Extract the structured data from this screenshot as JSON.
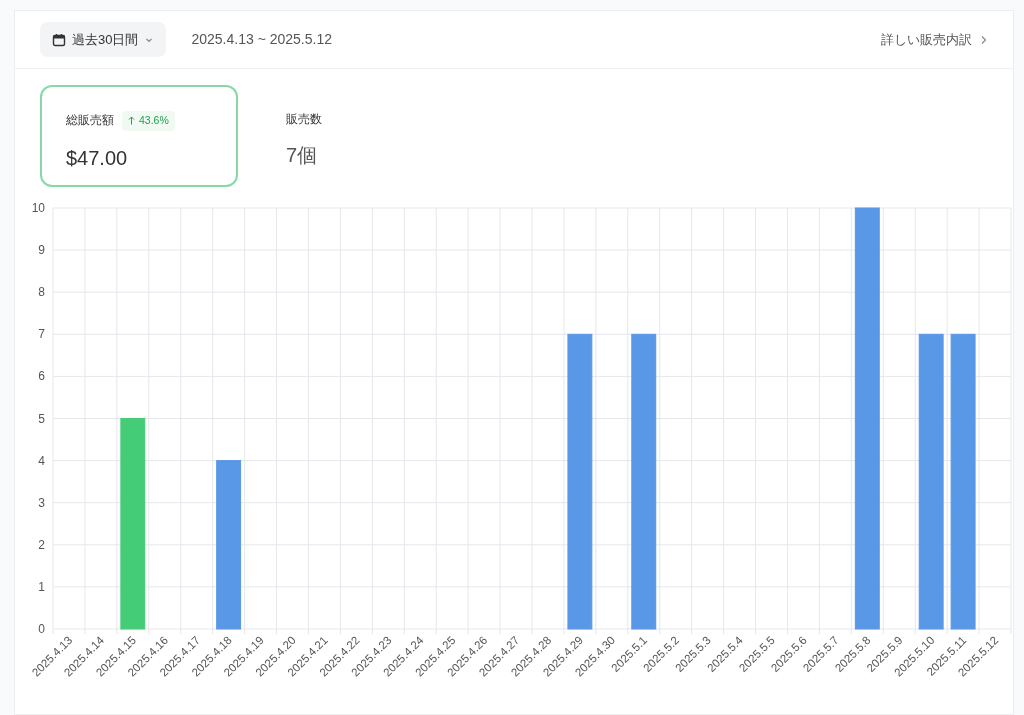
{
  "header": {
    "period_button": "過去30日間",
    "date_range": "2025.4.13 ~ 2025.5.12",
    "detail_link": "詳しい販売内訳"
  },
  "stats": [
    {
      "label": "総販売額",
      "badge": "43.6%",
      "value": "$47.00",
      "selected": true
    },
    {
      "label": "販売数",
      "value": "7個",
      "selected": false
    }
  ],
  "chart_data": {
    "type": "bar",
    "stacked": true,
    "categories": [
      "2025.4.13",
      "2025.4.14",
      "2025.4.15",
      "2025.4.16",
      "2025.4.17",
      "2025.4.18",
      "2025.4.19",
      "2025.4.20",
      "2025.4.21",
      "2025.4.22",
      "2025.4.23",
      "2025.4.24",
      "2025.4.25",
      "2025.4.26",
      "2025.4.27",
      "2025.4.28",
      "2025.4.29",
      "2025.4.30",
      "2025.5.1",
      "2025.5.2",
      "2025.5.3",
      "2025.5.4",
      "2025.5.5",
      "2025.5.6",
      "2025.5.7",
      "2025.5.8",
      "2025.5.9",
      "2025.5.10",
      "2025.5.11",
      "2025.5.12"
    ],
    "grid": true,
    "series": [
      {
        "color": "#4ade80",
        "values": [
          0,
          0,
          5,
          0,
          0,
          0,
          0,
          0,
          0,
          0,
          0,
          0,
          0,
          0,
          0,
          0,
          0,
          0,
          0,
          0,
          0,
          0,
          0,
          0,
          0,
          0,
          0,
          0,
          0,
          0
        ]
      },
      {
        "color": "#60a5fa",
        "values": [
          0,
          0,
          0,
          0,
          0,
          4,
          0,
          0,
          0,
          0,
          0,
          0,
          0,
          0,
          0,
          0,
          7,
          0,
          7,
          0,
          0,
          0,
          0,
          0,
          0,
          10,
          0,
          7,
          7,
          0
        ]
      }
    ],
    "ylim": [
      0,
      10
    ],
    "yticks": [
      0,
      1,
      2,
      3,
      4,
      5,
      6,
      7,
      8,
      9,
      10
    ]
  }
}
